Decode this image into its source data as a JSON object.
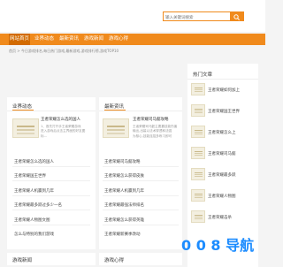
{
  "search": {
    "placeholder": "输入关键词搜索"
  },
  "nav": [
    {
      "label": "网站首页",
      "active": true
    },
    {
      "label": "业界动态"
    },
    {
      "label": "最新资讯"
    },
    {
      "label": "游戏新闻"
    },
    {
      "label": "游戏心得"
    }
  ],
  "breadcrumb": "首页 > 今日游戏排名,每日热门游戏,最新游戏,游戏排行榜,游戏TOP10",
  "left": {
    "title": "业界动态",
    "feature_title": "王者荣耀怎么选的国人",
    "feature_desc": [
      "1、首先打开手王者荣耀游戏",
      "进入游戏后点击主界面的好友图",
      "标..."
    ],
    "items": [
      "王者荣耀怎么选的国人",
      "王者荣耀国王世界",
      "王者荣耀人机赢到几年",
      "王者荣耀最多跃过多少一名",
      "王者荣耀人物图文图",
      "怎么与特别的我们游戏"
    ],
    "more": "更多"
  },
  "mid": {
    "title": "最新资讯",
    "feature_title": "王者荣耀司马懿攻略",
    "feature_desc": [
      "王者荣耀司马懿主要靠技能伤害",
      "输出,出装以法术穿透和法强",
      "为核心,技能连招多练习即可"
    ],
    "items": [
      "王者荣耀司马懿攻略",
      "王者荣耀怎么获得皮肤",
      "王者荣耀人机赢到几年",
      "王者荣耀最强法师排名",
      "王者荣耀怎么获得英雄",
      "王者荣耀新赛季改动"
    ],
    "more": "更多"
  },
  "right": {
    "title": "热门文章",
    "items": [
      "王者荣耀如何加上",
      "王者荣耀国王世界",
      "王者荣耀怎么上",
      "王者荣耀司马懿",
      "王者荣耀最多跃",
      "王者荣耀人物图",
      "王者荣耀击杀"
    ]
  },
  "bottom": {
    "left_title": "游戏新闻",
    "mid_title": "游戏心得"
  },
  "watermark": {
    "text": "0 0 8 导航"
  }
}
